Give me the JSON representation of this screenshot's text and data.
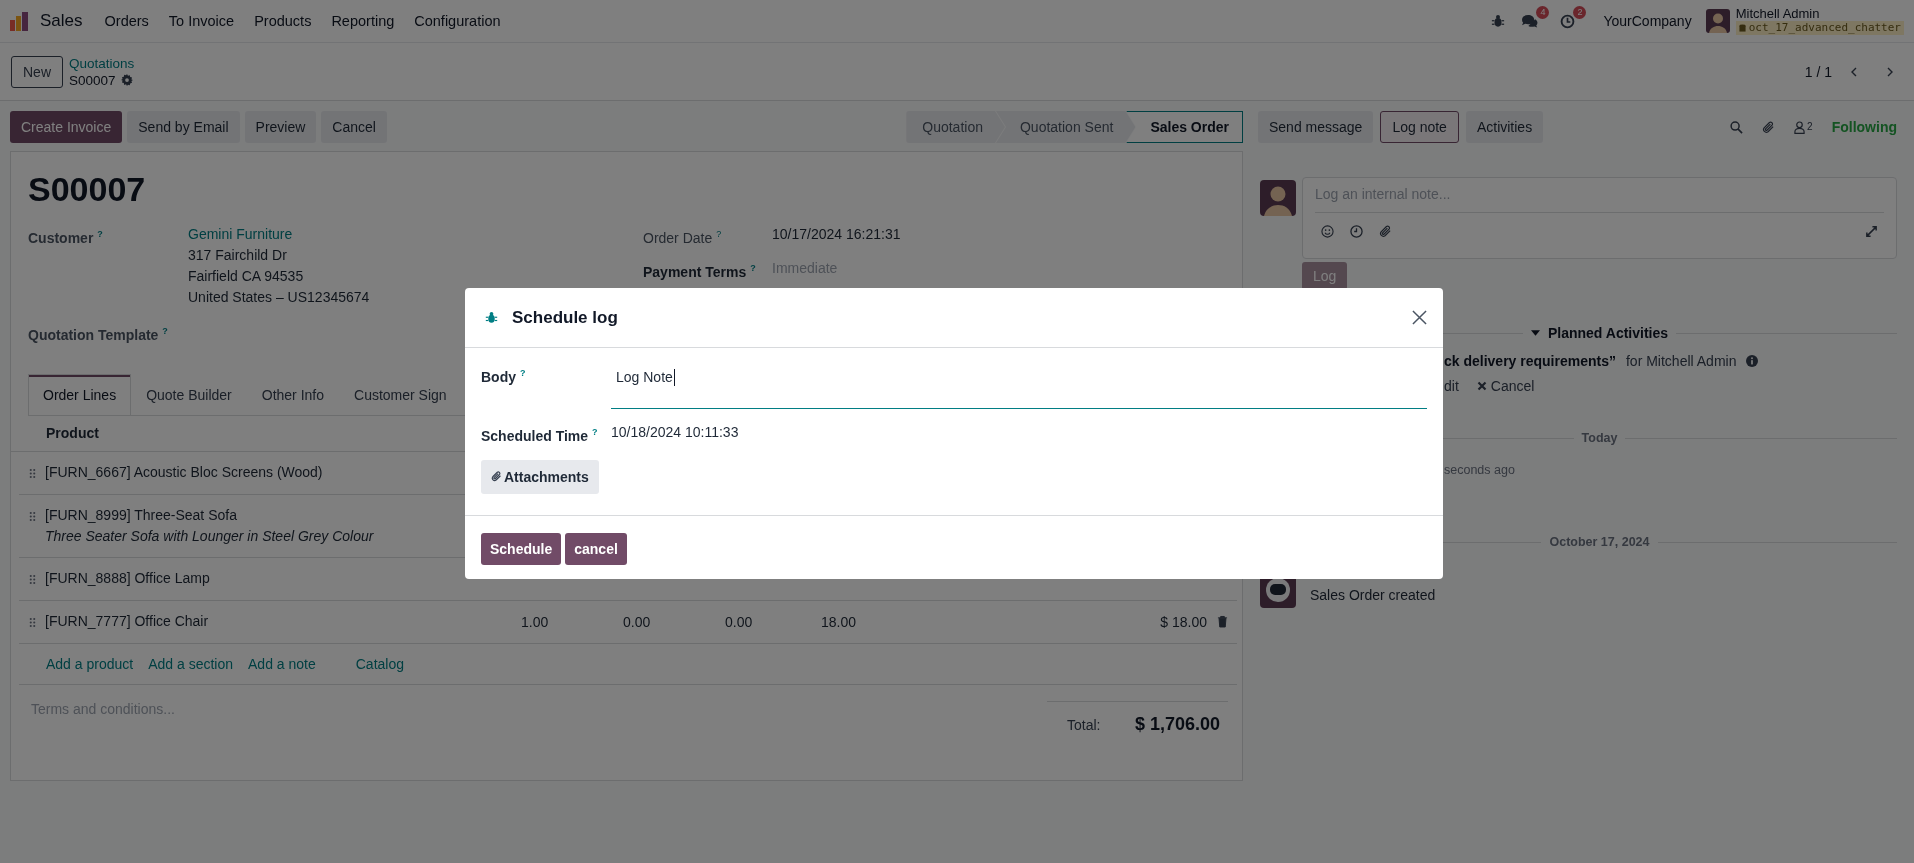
{
  "navbar": {
    "app": "Sales",
    "menu": [
      "Orders",
      "To Invoice",
      "Products",
      "Reporting",
      "Configuration"
    ],
    "messages_badge": "4",
    "activities_badge": "2",
    "company": "YourCompany",
    "user": "Mitchell Admin",
    "database": "oct_17_advanced_chatter"
  },
  "breadcrumb": {
    "new_button": "New",
    "parent": "Quotations",
    "current": "S00007"
  },
  "pager": "1 / 1",
  "actions": [
    {
      "label": "Create Invoice",
      "kind": "primary"
    },
    {
      "label": "Send by Email",
      "kind": "secondary"
    },
    {
      "label": "Preview",
      "kind": "secondary"
    },
    {
      "label": "Cancel",
      "kind": "secondary"
    }
  ],
  "stages": [
    {
      "label": "Quotation",
      "selected": false
    },
    {
      "label": "Quotation Sent",
      "selected": false
    },
    {
      "label": "Sales Order",
      "selected": true
    }
  ],
  "form": {
    "title": "S00007",
    "left_fields": [
      {
        "label": "Customer",
        "help": "?",
        "link": "Gemini Furniture",
        "lines": [
          "317 Fairchild Dr",
          "Fairfield CA 94535",
          "United States – US12345674"
        ]
      },
      {
        "label": "Quotation Template",
        "help": "?"
      }
    ],
    "right_fields": [
      {
        "label": "Order Date",
        "help": "?",
        "required": false,
        "value": "10/17/2024 16:21:31"
      },
      {
        "label": "Payment Terms",
        "help": "?",
        "required": true,
        "placeholder": "Immediate"
      }
    ],
    "tabs": [
      {
        "label": "Order Lines",
        "selected": true
      },
      {
        "label": "Quote Builder",
        "selected": false
      },
      {
        "label": "Other Info",
        "selected": false
      },
      {
        "label": "Customer Sign",
        "selected": false
      }
    ],
    "columns": [
      "Product"
    ],
    "lines": [
      {
        "product": "[FURN_6667] Acoustic Bloc Screens (Wood)"
      },
      {
        "product": "[FURN_8999] Three-Seat Sofa",
        "description": "Three Seater Sofa with Lounger in Steel Grey Colour"
      },
      {
        "product": "[FURN_8888] Office Lamp"
      },
      {
        "product": "[FURN_7777] Office Chair",
        "cells": [
          "1.00",
          "0.00",
          "0.00",
          "18.00"
        ],
        "subtotal": "$ 18.00"
      }
    ],
    "add_links": [
      "Add a product",
      "Add a section",
      "Add a note",
      "Catalog"
    ],
    "terms_placeholder": "Terms and conditions...",
    "total_label": "Total:",
    "total": "$ 1,706.00"
  },
  "chatter": {
    "buttons": [
      {
        "label": "Send message",
        "selected": false
      },
      {
        "label": "Log note",
        "selected": true
      },
      {
        "label": "Activities",
        "selected": false
      }
    ],
    "followers": "2",
    "following": "Following",
    "composer_placeholder": "Log an internal note...",
    "log_button": "Log",
    "planned_header": "Planned Activities",
    "activity": {
      "summary": "ck delivery requirements”",
      "assignee": "for Mitchell Admin",
      "edit": "dit",
      "cancel": "Cancel"
    },
    "today": "Today",
    "time_ago": "seconds ago",
    "date": "October 17, 2024",
    "message": "Sales Order created"
  },
  "modal": {
    "title": "Schedule log",
    "body_label": "Body",
    "body_help": "?",
    "body_value": "Log Note",
    "time_label": "Scheduled Time",
    "time_help": "?",
    "time_value": "10/18/2024 10:11:33",
    "attachments": "Attachments",
    "buttons": [
      "Schedule",
      "cancel"
    ]
  }
}
